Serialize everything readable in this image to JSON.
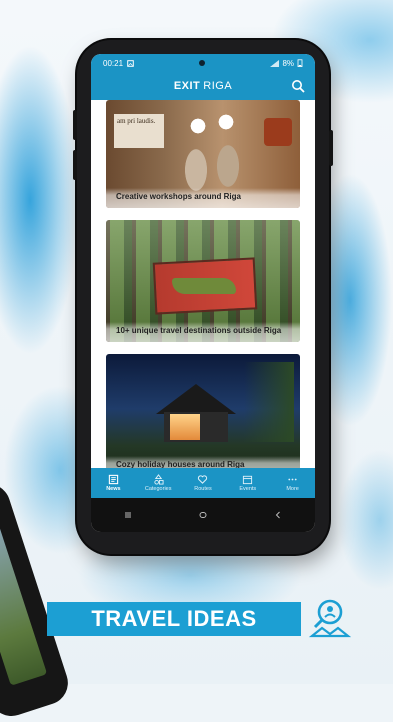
{
  "status_bar": {
    "time": "00:21",
    "battery": "8%"
  },
  "app_bar": {
    "brand_bold": "EXIT",
    "brand_light": "RIGA"
  },
  "feed": {
    "cards": [
      {
        "caption": "Creative workshops around Riga",
        "sign_text": "am pri laudis."
      },
      {
        "caption": "10+ unique travel destinations outside Riga"
      },
      {
        "caption": "Cozy holiday houses around Riga"
      }
    ]
  },
  "tabs": [
    {
      "label": "News",
      "icon": "news-icon",
      "active": true
    },
    {
      "label": "Categories",
      "icon": "categories-icon"
    },
    {
      "label": "Routes",
      "icon": "heart-icon"
    },
    {
      "label": "Events",
      "icon": "calendar-icon"
    },
    {
      "label": "More",
      "icon": "more-dots-icon"
    }
  ],
  "banner": {
    "text": "TRAVEL IDEAS"
  },
  "colors": {
    "brand": "#1b94c5",
    "banner": "#1c9fd3"
  }
}
